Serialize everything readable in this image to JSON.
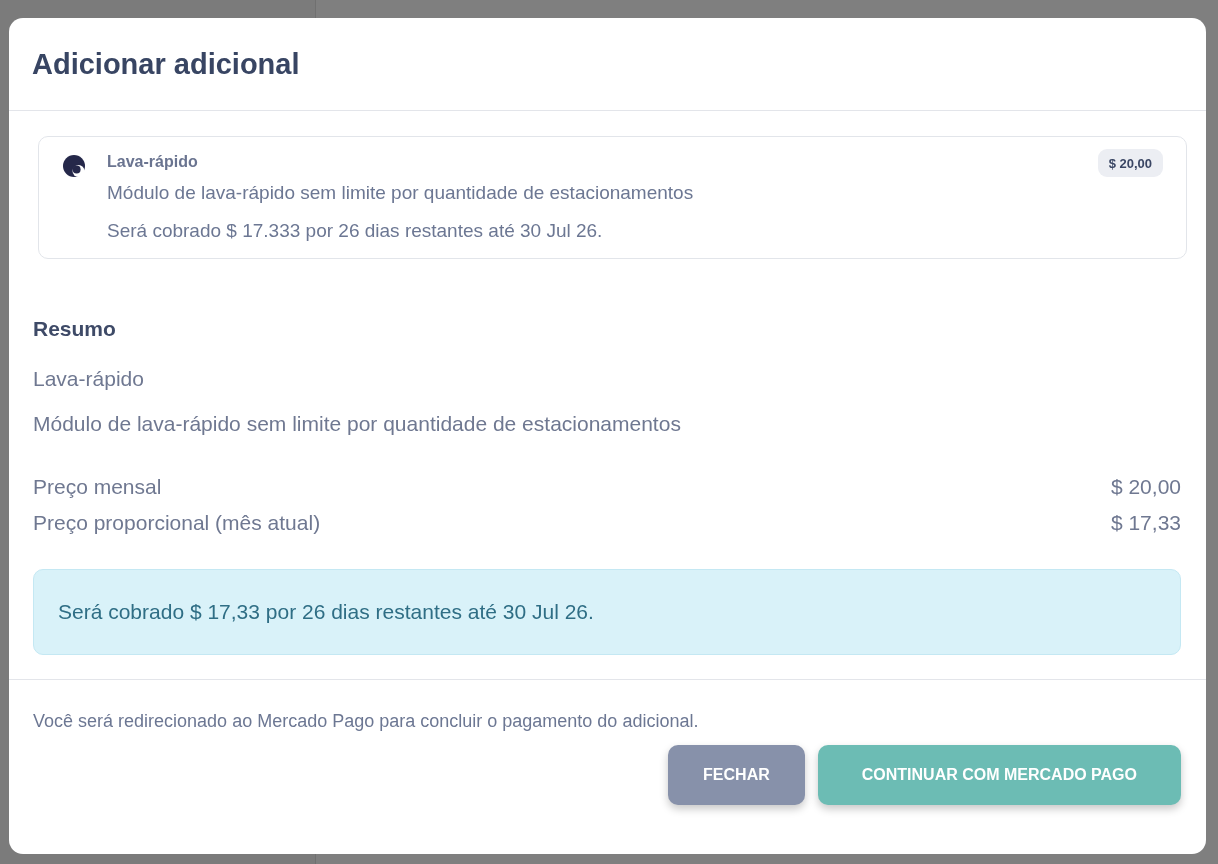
{
  "dialog": {
    "title": "Adicionar adicional",
    "addon": {
      "name": "Lava-rápido",
      "description": "Módulo de lava-rápido sem limite por quantidade de estacionamentos",
      "charge_note": "Será cobrado $ 17.333 por 26 dias restantes até 30 Jul 26.",
      "price": "$ 20,00"
    },
    "summary": {
      "title": "Resumo",
      "name": "Lava-rápido",
      "description": "Módulo de lava-rápido sem limite por quantidade de estacionamentos",
      "lines": [
        {
          "label": "Preço mensal",
          "value": "$ 20,00"
        },
        {
          "label": "Preço proporcional (mês atual)",
          "value": "$ 17,33"
        }
      ]
    },
    "alert": {
      "text": "Será cobrado $ 17,33 por 26 dias restantes até 30 Jul 26."
    },
    "footer": {
      "note": "Você será redirecionado ao Mercado Pago para concluir o pagamento do adicional.",
      "buttons": [
        {
          "label": "FECHAR",
          "kind": "secondary"
        },
        {
          "label": "CONTINUAR COM MERCADO PAGO",
          "kind": "primary"
        }
      ]
    }
  }
}
